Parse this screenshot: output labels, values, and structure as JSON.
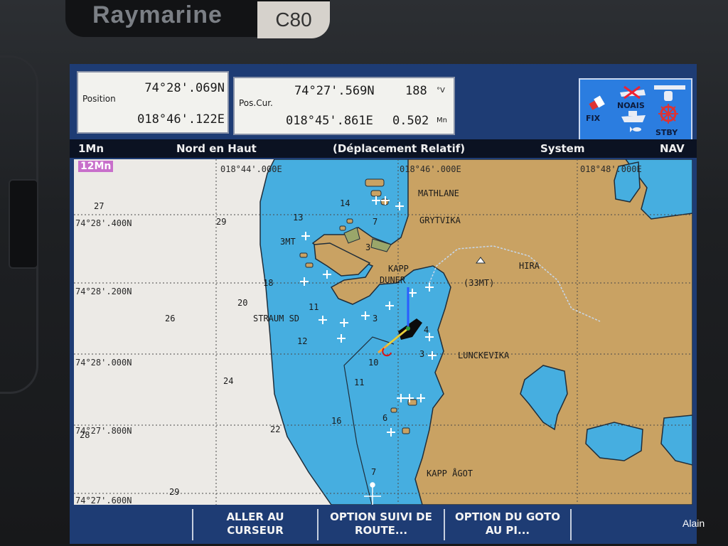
{
  "device": {
    "brand": "Raymarine",
    "model": "C80"
  },
  "position": {
    "label": "Position",
    "lat": "74°28'.069N",
    "lon": "018°46'.122E"
  },
  "cursor": {
    "label": "Pos.Cur.",
    "lat": "74°27'.569N",
    "lon": "018°45'.861E",
    "bearing": "188",
    "bearing_unit": "°V",
    "range": "0.502",
    "range_unit": "Mn"
  },
  "status": {
    "fix": "FIX",
    "ais": "NOAIS",
    "pilot": "STBY"
  },
  "titlebar": {
    "range": "1Mn",
    "orientation": "Nord en Haut",
    "motion": "(Déplacement Relatif)",
    "system": "System",
    "mode": "NAV"
  },
  "chart": {
    "scale_badge": "12Mn",
    "longitudes": [
      "018°44'.000E",
      "018°46'.000E",
      "018°48'.000E"
    ],
    "latitudes": [
      "74°28'.400N",
      "74°28'.200N",
      "74°28'.000N",
      "74°27'.800N",
      "74°27'.600N"
    ],
    "place_names": [
      "MATHLANE",
      "GRYTVIKA",
      "KAPP",
      "DUNER",
      "HIRA",
      "(33MT)",
      "STRAUM SD",
      "LUNCKEVIKA",
      "KAPP ÅGOT",
      "3MT"
    ],
    "depths": [
      "27",
      "29",
      "13",
      "14",
      "7",
      "3",
      "18",
      "20",
      "11",
      "26",
      "12",
      "3",
      "4",
      "3",
      "10",
      "24",
      "11",
      "16",
      "6",
      "28",
      "22",
      "7",
      "29"
    ]
  },
  "softkeys": [
    {
      "line1": "ALLER AU",
      "line2": "CURSEUR"
    },
    {
      "line1": "OPTION SUIVI DE",
      "line2": "ROUTE..."
    },
    {
      "line1": "OPTION DU GOTO",
      "line2": "AU PI..."
    }
  ],
  "photo_credit": "Alain",
  "colors": {
    "land": "#c9a263",
    "water": "#46aee0",
    "deep": "#eceae6",
    "screen_frame": "#1e3c74",
    "scale_badge": "#c86fcb"
  }
}
